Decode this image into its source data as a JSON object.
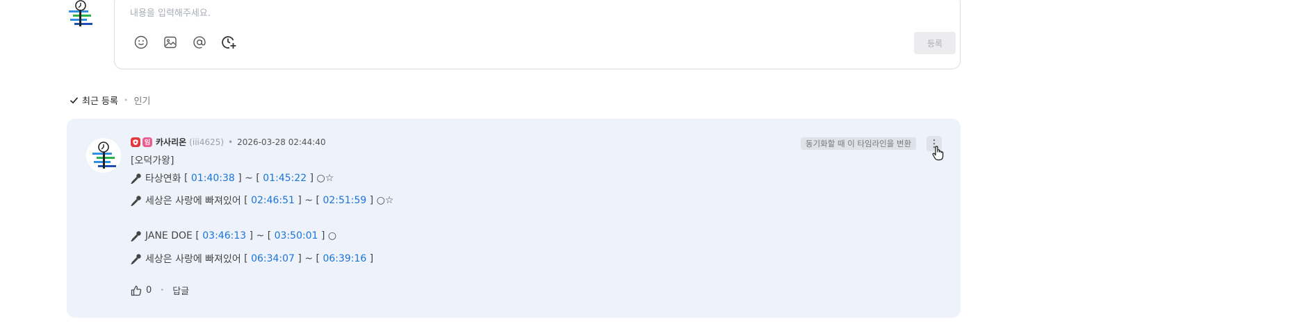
{
  "editor": {
    "placeholder": "내용을 입력해주세요.",
    "submit_label": "등록"
  },
  "sort": {
    "recent": "최근 등록",
    "popular": "인기"
  },
  "comment": {
    "badge_label": "임",
    "nickname": "카사리온",
    "user_id": "(iii4625)",
    "separator": "•",
    "date": "2026-03-28 02:44:40",
    "sync_label": "동기화할 때 이 타임라인을 변환",
    "intro": "[오덕가왕]",
    "lines": [
      {
        "title": "타상연화",
        "start": "01:40:38",
        "end": "01:45:22",
        "marks": "○☆"
      },
      {
        "title": "세상은 사랑에 빠져있어",
        "start": "02:46:51",
        "end": "02:51:59",
        "marks": "○☆"
      },
      {
        "title": "JANE DOE",
        "start": "03:46:13",
        "end": "03:50:01",
        "marks": "○"
      },
      {
        "title": "세상은 사랑에 빠져있어",
        "start": "06:34:07",
        "end": "06:39:16",
        "marks": ""
      }
    ],
    "bracket_open": "[",
    "bracket_close": "]",
    "tilde": "~",
    "like_count": "0",
    "reply_label": "답글"
  },
  "icons": {
    "mic": "microphone-icon",
    "emoji": "smiley-icon",
    "image": "image-icon",
    "mention": "at-icon",
    "time": "clock-plus-icon",
    "check": "check-icon",
    "thumb": "thumbs-up-icon",
    "more": "kebab-icon"
  },
  "colors": {
    "timestamp": "#1a73d9",
    "card_bg": "#eef3fb",
    "badge_red": "#e2373d",
    "badge_pink": "#ee5b8f"
  }
}
